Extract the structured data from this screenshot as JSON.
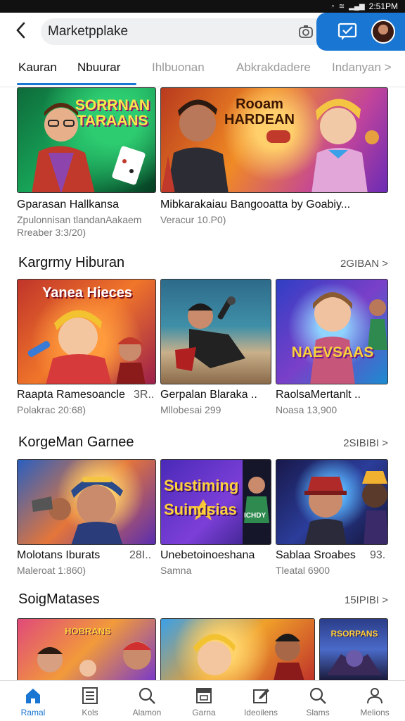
{
  "status_bar": {
    "time": "2:51PM"
  },
  "search": {
    "value": "Marketpplake"
  },
  "tabs": [
    {
      "label": "Kauran"
    },
    {
      "label": "Nbuurar"
    },
    {
      "label": "Ihlbuonan"
    },
    {
      "label": "Abkrakdadere"
    },
    {
      "label": "Indanyan >"
    }
  ],
  "section0": {
    "cards": [
      {
        "title": "Gparasan Hallkansa",
        "sub1": "Zpulonnisan tlandanAakaem",
        "sub2": "Rreaber 3:3/20)",
        "thumb_text": "SORRNAN TARAANS"
      },
      {
        "title": "Mibkarakaiau Bangooatta by Goabiy...",
        "sub1": "Veracur 10.P0)",
        "thumb_text": "Rooam HARDEAN"
      }
    ]
  },
  "section1": {
    "title": "Kargrmy Hiburan",
    "more": "2GIBAN >",
    "cards": [
      {
        "title": "Raapta Ramesoancle",
        "extra": "3R..",
        "sub": "Polakrac 20:68)",
        "thumb_text": "Yanea Hieces"
      },
      {
        "title": "Gerpalan Blaraka ..",
        "sub": "Mllobesai 299",
        "thumb_text": ""
      },
      {
        "title": "RaolsaMertanlt ..",
        "sub": "Noasa 13,900",
        "thumb_text": "NAEVSAAS"
      }
    ]
  },
  "section2": {
    "title": "KorgeMan Garnee",
    "more": "2SIBIBI >",
    "cards": [
      {
        "title": "Molotans Iburats",
        "extra": "28I..",
        "sub": "Maleroat 1:860)",
        "thumb_text": ""
      },
      {
        "title": "Unebetoinoeshana",
        "sub": "Samna",
        "thumb_text": "Sustiming Suindsias",
        "thumb_text2": "ICHDY"
      },
      {
        "title": "Sablaa Sroabes",
        "extra": "93.",
        "sub": "Tleatal 6900",
        "thumb_text": ""
      }
    ]
  },
  "section3": {
    "title": "SoigMatases",
    "more": "15IPIBI >",
    "cards": [
      {
        "thumb_text": "HOBRANS"
      },
      {
        "thumb_text": ""
      },
      {
        "thumb_text": "RSORPANS"
      }
    ]
  },
  "bottom_nav": [
    {
      "label": "Ramal",
      "icon": "home-icon"
    },
    {
      "label": "Kols",
      "icon": "document-icon"
    },
    {
      "label": "Alamon",
      "icon": "search-icon"
    },
    {
      "label": "Garna",
      "icon": "image-icon"
    },
    {
      "label": "Ideoilens",
      "icon": "edit-icon"
    },
    {
      "label": "Slams",
      "icon": "search-icon"
    },
    {
      "label": "Melions",
      "icon": "person-icon"
    }
  ],
  "colors": {
    "accent": "#1976d2"
  }
}
